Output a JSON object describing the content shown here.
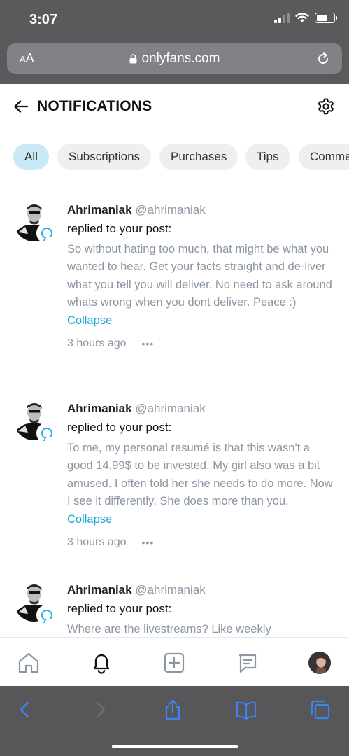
{
  "status": {
    "time": "3:07"
  },
  "browser": {
    "aa_label_big": "A",
    "aa_label_small": "A",
    "url": "onlyfans.com"
  },
  "header": {
    "title": "NOTIFICATIONS"
  },
  "filters": [
    "All",
    "Subscriptions",
    "Purchases",
    "Tips",
    "Comme"
  ],
  "notifications": [
    {
      "name": "Ahrimaniak",
      "handle": "@ahrimaniak",
      "action": "replied to your post:",
      "text": "So without hating too much, that might be what you wanted to hear. Get your facts straight and de-liver what you tell you will deliver. No need to ask around whats wrong when you dont deliver. Peace :)",
      "link": "Collapse",
      "time": "3 hours ago",
      "more": "•••"
    },
    {
      "name": "Ahrimaniak",
      "handle": "@ahrimaniak",
      "action": "replied to your post:",
      "text": "To me, my personal resumé is that this wasn't a good 14,99$ to be invested. My girl also was a bit amused. I often told her she needs to do more. Now I see it differently. She does more than you.",
      "link": "Collapse",
      "time": "3 hours ago",
      "more": "•••"
    },
    {
      "name": "Ahrimaniak",
      "handle": "@ahrimaniak",
      "action": "replied to your post:",
      "text": "Where are the livestreams? Like weekly"
    }
  ],
  "colors": {
    "accent": "#00aff0",
    "chip_active": "#c9e9f7",
    "muted_text": "#8a96a3",
    "safari_blue": "#3a84f3"
  }
}
